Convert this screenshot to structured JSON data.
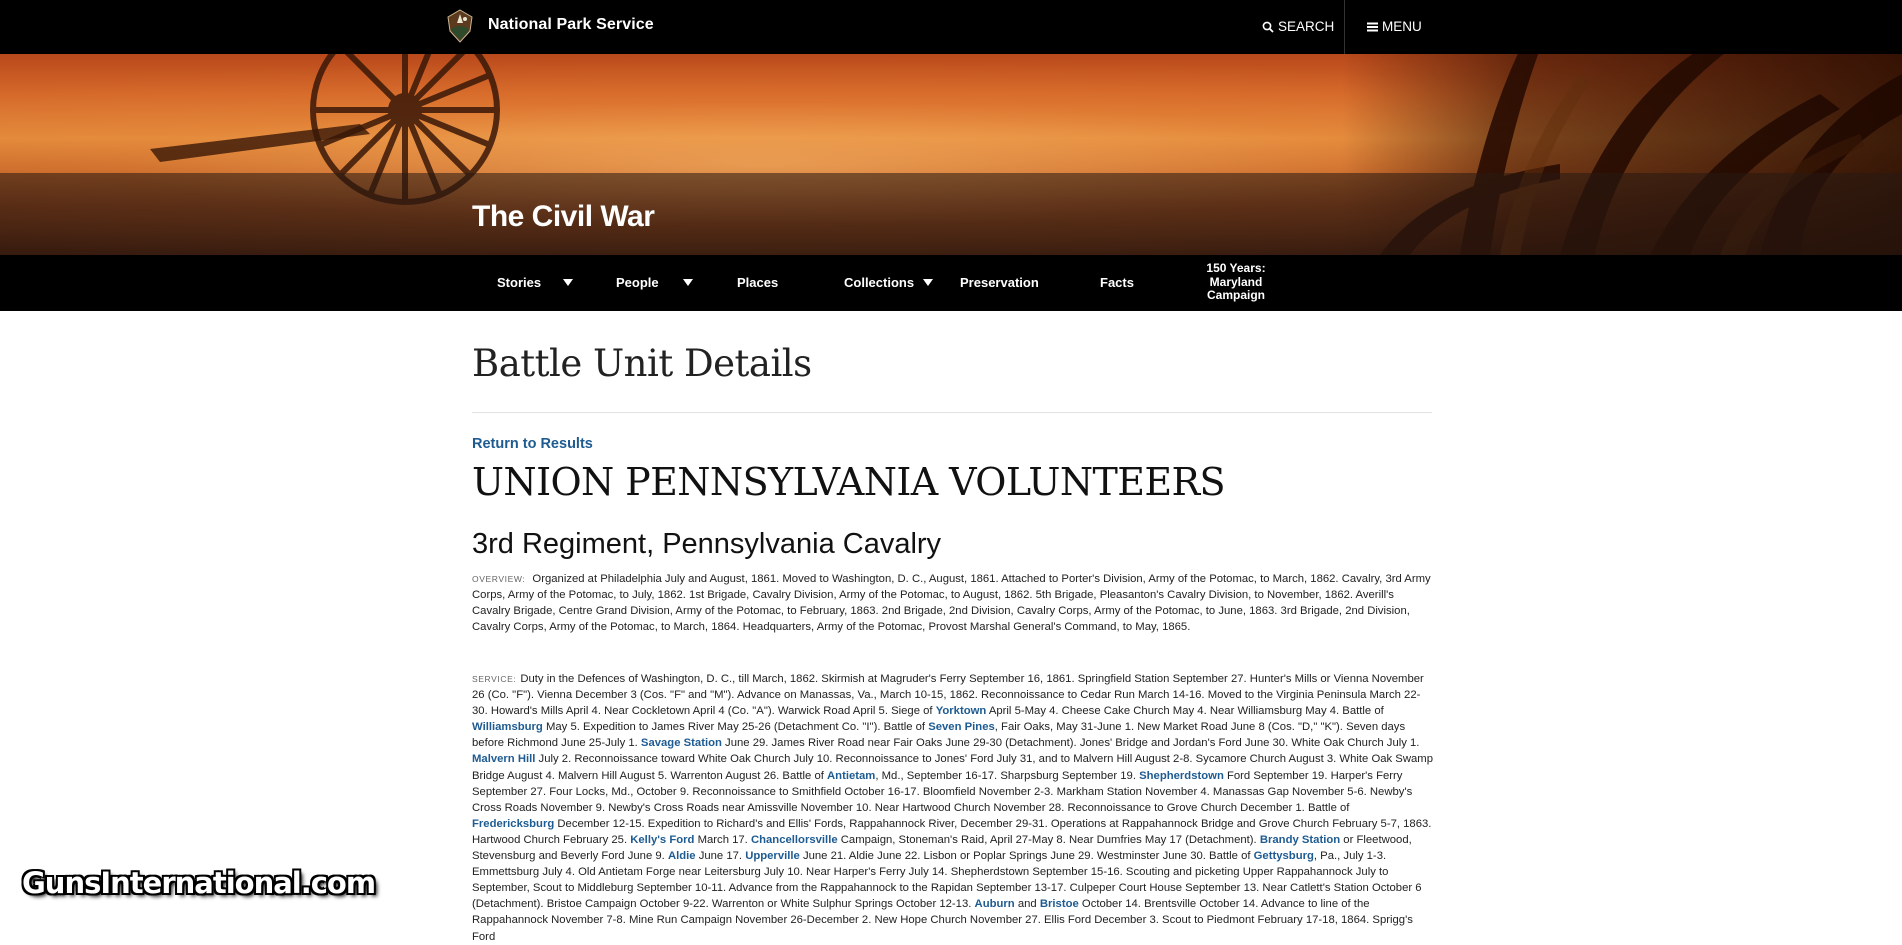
{
  "header": {
    "brand": "National Park Service",
    "search_label": "SEARCH",
    "menu_label": "MENU"
  },
  "hero": {
    "site_title": "The Civil War"
  },
  "nav": {
    "items": [
      {
        "label": "Stories",
        "has_dropdown": true
      },
      {
        "label": "People",
        "has_dropdown": true
      },
      {
        "label": "Places",
        "has_dropdown": false
      },
      {
        "label": "Collections",
        "has_dropdown": true
      },
      {
        "label": "Preservation",
        "has_dropdown": false
      },
      {
        "label": "Facts",
        "has_dropdown": false
      }
    ],
    "special_lines": [
      "150 Years:",
      "Maryland",
      "Campaign"
    ]
  },
  "page": {
    "title": "Battle Unit Details",
    "return_link": "Return to Results",
    "organization": "UNION PENNSYLVANIA VOLUNTEERS",
    "unit": "3rd Regiment, Pennsylvania Cavalry"
  },
  "overview": {
    "label": "OVERVIEW:",
    "text": "Organized at Philadelphia July and August, 1861. Moved to Washington, D. C., August, 1861. Attached to Porter's Division, Army of the Potomac, to March, 1862. Cavalry, 3rd Army Corps, Army of the Potomac, to July, 1862. 1st Brigade, Cavalry Division, Army of the Potomac, to August, 1862. 5th Brigade, Pleasanton's Cavalry Division, to November, 1862. Averill's Cavalry Brigade, Centre Grand Division, Army of the Potomac, to February, 1863. 2nd Brigade, 2nd Division, Cavalry Corps, Army of the Potomac, to June, 1863. 3rd Brigade, 2nd Division, Cavalry Corps, Army of the Potomac, to March, 1864. Headquarters, Army of the Potomac, Provost Marshal General's Command, to May, 1865."
  },
  "service": {
    "label": "SERVICE:",
    "segments": [
      {
        "text": "Duty in the Defences of Washington, D. C., till March, 1862. Skirmish at Magruder's Ferry September 16, 1861. Springfield Station September 27. Hunter's Mills or Vienna November 26 (Co. \"F\"). Vienna December 3 (Cos. \"F\" and \"M\"). Advance on Manassas, Va., March 10-15, 1862. Reconnoissance to Cedar Run March 14-16. Moved to the Virginia Peninsula March 22-30. Howard's Mills April 4. Near Cockletown April 4 (Co. \"A\"). Warwick Road April 5. Siege of "
      },
      {
        "text": "Yorktown",
        "link": true
      },
      {
        "text": " April 5-May 4. Cheese Cake Church May 4. Near Williamsburg May 4. Battle of "
      },
      {
        "text": "Williamsburg",
        "link": true
      },
      {
        "text": " May 5. Expedition to James River May 25-26 (Detachment Co. \"I\"). Battle of "
      },
      {
        "text": "Seven Pines",
        "link": true
      },
      {
        "text": ", Fair Oaks, May 31-June 1. New Market Road June 8 (Cos. \"D,\" \"K\"). Seven days before Richmond June 25-July 1. "
      },
      {
        "text": "Savage Station",
        "link": true
      },
      {
        "text": " June 29. James River Road near Fair Oaks June 29-30 (Detachment). Jones' Bridge and Jordan's Ford June 30. White Oak Church July 1. "
      },
      {
        "text": "Malvern Hill",
        "link": true
      },
      {
        "text": " July 2. Reconnoissance toward White Oak Church July 10. Reconnoissance to Jones' Ford July 31, and to Malvern Hill August 2-8. Sycamore Church August 3. White Oak Swamp Bridge August 4. Malvern Hill August 5. Warrenton August 26. Battle of "
      },
      {
        "text": "Antietam",
        "link": true
      },
      {
        "text": ", Md., September 16-17. Sharpsburg September 19. "
      },
      {
        "text": "Shepherdstown",
        "link": true
      },
      {
        "text": " Ford September 19. Harper's Ferry September 27. Four Locks, Md., October 9. Reconnoissance to Smithfield October 16-17. Bloomfield November 2-3. Markham Station November 4. Manassas Gap November 5-6. Newby's Cross Roads November 9. Newby's Cross Roads near Amissville November 10. Near Hartwood Church November 28. Reconnoissance to Grove Church December 1. Battle of "
      },
      {
        "text": "Fredericksburg",
        "link": true
      },
      {
        "text": " December 12-15. Expedition to Richard's and Ellis' Fords, Rappahannock River, December 29-31. Operations at Rappahannock Bridge and Grove Church February 5-7, 1863. Hartwood Church February 25. "
      },
      {
        "text": "Kelly's Ford",
        "link": true
      },
      {
        "text": " March 17. "
      },
      {
        "text": "Chancellorsville",
        "link": true
      },
      {
        "text": " Campaign, Stoneman's Raid, April 27-May 8. Near Dumfries May 17 (Detachment). "
      },
      {
        "text": "Brandy Station",
        "link": true
      },
      {
        "text": " or Fleetwood, Stevensburg and Beverly Ford June 9. "
      },
      {
        "text": "Aldie",
        "link": true
      },
      {
        "text": " June 17. "
      },
      {
        "text": "Upperville",
        "link": true
      },
      {
        "text": " June 21. Aldie June 22. Lisbon or Poplar Springs June 29. Westminster June 30. Battle of "
      },
      {
        "text": "Gettysburg",
        "link": true
      },
      {
        "text": ", Pa., July 1-3. Emmettsburg July 4. Old Antietam Forge near Leitersburg July 10. Near Harper's Ferry July 14. Shepherdstown September 15-16. Scouting and picketing Upper Rappahannock July to September, Scout to Middleburg September 10-11. Advance from the Rappahannock to the Rapidan September 13-17. Culpeper Court House September 13. Near Catlett's Station October 6 (Detachment). Bristoe Campaign October 9-22. Warrenton or White Sulphur Springs October 12-13. "
      },
      {
        "text": "Auburn",
        "link": true
      },
      {
        "text": " and "
      },
      {
        "text": "Bristoe",
        "link": true
      },
      {
        "text": " October 14. Brentsville October 14. Advance to line of the Rappahannock November 7-8. Mine Run Campaign November 26-December 2. New Hope Church November 27. Ellis Ford December 3. Scout to Piedmont February 17-18, 1864. Sprigg's Ford"
      }
    ]
  },
  "watermark": "GunsInternational.com"
}
